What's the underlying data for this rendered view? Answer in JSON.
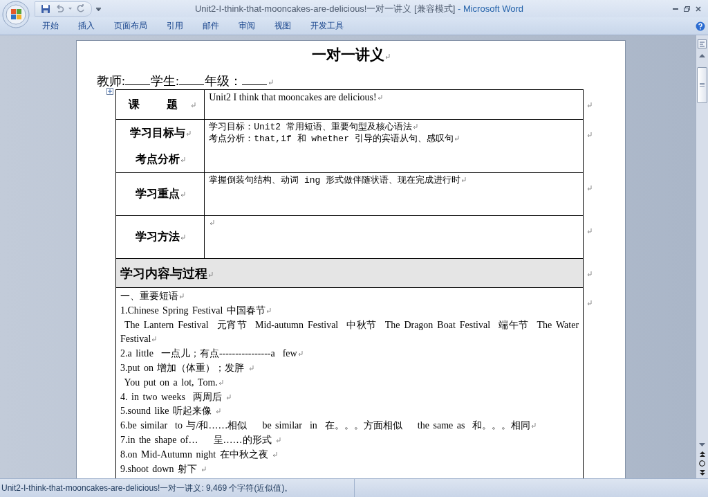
{
  "window": {
    "title": "Unit2-I-think-that-mooncakes-are-delicious!一对一讲义 [兼容模式]",
    "app": " - Microsoft Word"
  },
  "ribbon_tabs": [
    {
      "label": "开始",
      "selected": false
    },
    {
      "label": "插入",
      "selected": false
    },
    {
      "label": "页面布局",
      "selected": false
    },
    {
      "label": "引用",
      "selected": false
    },
    {
      "label": "邮件",
      "selected": false
    },
    {
      "label": "审阅",
      "selected": false
    },
    {
      "label": "视图",
      "selected": false
    },
    {
      "label": "开发工具",
      "selected": false
    }
  ],
  "document": {
    "heading": "一对一讲义",
    "info_fields": [
      {
        "label": "教师:"
      },
      {
        "label": "学生:"
      },
      {
        "label": "年级："
      }
    ],
    "table": {
      "rows": [
        {
          "label": [
            "课 题"
          ],
          "content": [
            "Unit2 I think that mooncakes are delicious!"
          ]
        },
        {
          "label": [
            "学习目标与",
            "考点分析"
          ],
          "content": [
            "学习目标：Unit2 常用短语、重要句型及核心语法",
            "考点分析：that,if 和 whether 引导的宾语从句、感叹句"
          ]
        },
        {
          "label": [
            "学习重点"
          ],
          "content": [
            "掌握倒装句结构、动词 ing 形式做伴随状语、现在完成进行时"
          ]
        },
        {
          "label": [
            "学习方法"
          ],
          "content": []
        }
      ],
      "section_header": "学习内容与过程",
      "body_lines": [
        "一、重要短语",
        "1.Chinese Spring Festival 中国春节",
        " The Lantern Festival  元宵节  Mid-autumn Festival  中秋节  The Dragon Boat Festival  端午节  The Water Festival",
        "2.a little  一点儿；有点----------------a  few",
        "3.put on 增加（体重）；发胖 ",
        " You put on a lot, Tom.",
        "4. in two weeks  两周后 ",
        "5.sound like 听起来像 ",
        "6.be similar  to 与/和……相似    be similar  in  在。。。方面相似    the same as  和。。。相同",
        "7.in the shape of…    呈……的形式 ",
        "8.on Mid-Autumn night 在中秋之夜 ",
        "9.shoot down 射下 "
      ]
    }
  },
  "status_bar": {
    "text": "Unit2-I-think-that-mooncakes-are-delicious!一对一讲义: 9,469 个字符(近似值)。"
  }
}
